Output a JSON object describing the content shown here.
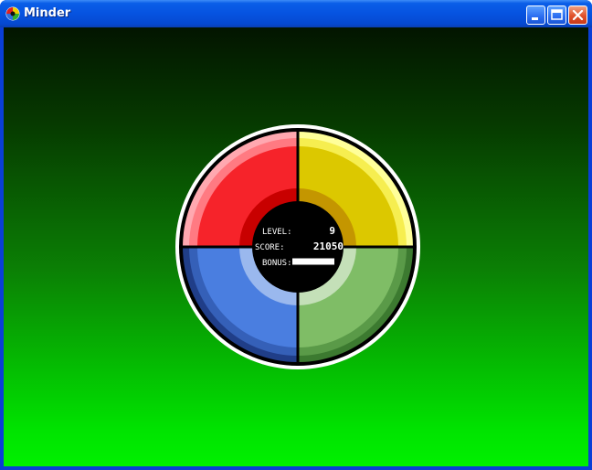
{
  "window": {
    "title": "Minder",
    "icon": "color-wheel-icon",
    "controls": [
      "minimize-icon",
      "maximize-icon",
      "close-icon"
    ]
  },
  "hud": {
    "level_label": "LEVEL:",
    "level_value": "9",
    "score_label": "SCORE:",
    "score_value": "21050",
    "bonus_label": "BONUS:",
    "bonus_fraction": 1.0
  },
  "colors": {
    "red": "#f6232a",
    "yellow": "#dcc800",
    "blue": "#4a7ee0",
    "green": "#7fbd66",
    "background_top": "#031500",
    "background_bottom": "#00f000"
  }
}
